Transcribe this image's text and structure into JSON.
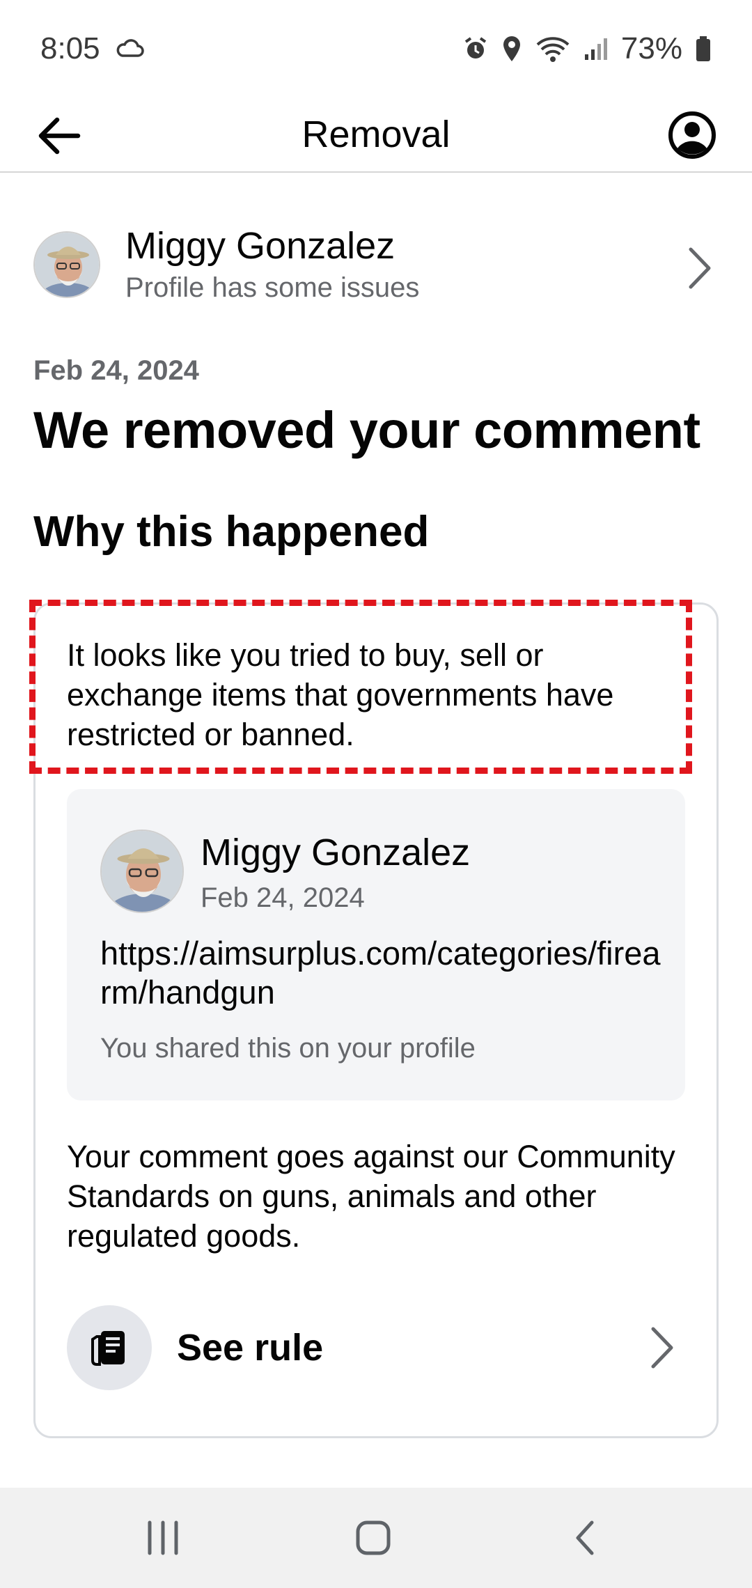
{
  "status_bar": {
    "time": "8:05",
    "battery": "73%"
  },
  "header": {
    "title": "Removal"
  },
  "profile": {
    "name": "Miggy Gonzalez",
    "status": "Profile has some issues"
  },
  "notice": {
    "date": "Feb 24, 2024",
    "title": "We removed your comment",
    "section_title": "Why this happened",
    "reason": "It looks like you tried to buy, sell or exchange items that governments have restricted or banned.",
    "comment": {
      "author": "Miggy Gonzalez",
      "date": "Feb 24, 2024",
      "text": "https://aimsurplus.com/categories/firearm/handgun",
      "note": "You shared this on your profile"
    },
    "standards": "Your comment goes against our Community Standards on guns, animals and other regulated goods.",
    "see_rule_label": "See rule"
  },
  "colors": {
    "highlight": "#e0161d",
    "secondary_text": "#65676b",
    "card_border": "#dadde1"
  },
  "icons": {
    "back": "arrow-left",
    "account": "user-circle",
    "rule": "book",
    "chevron": "chevron-right"
  }
}
